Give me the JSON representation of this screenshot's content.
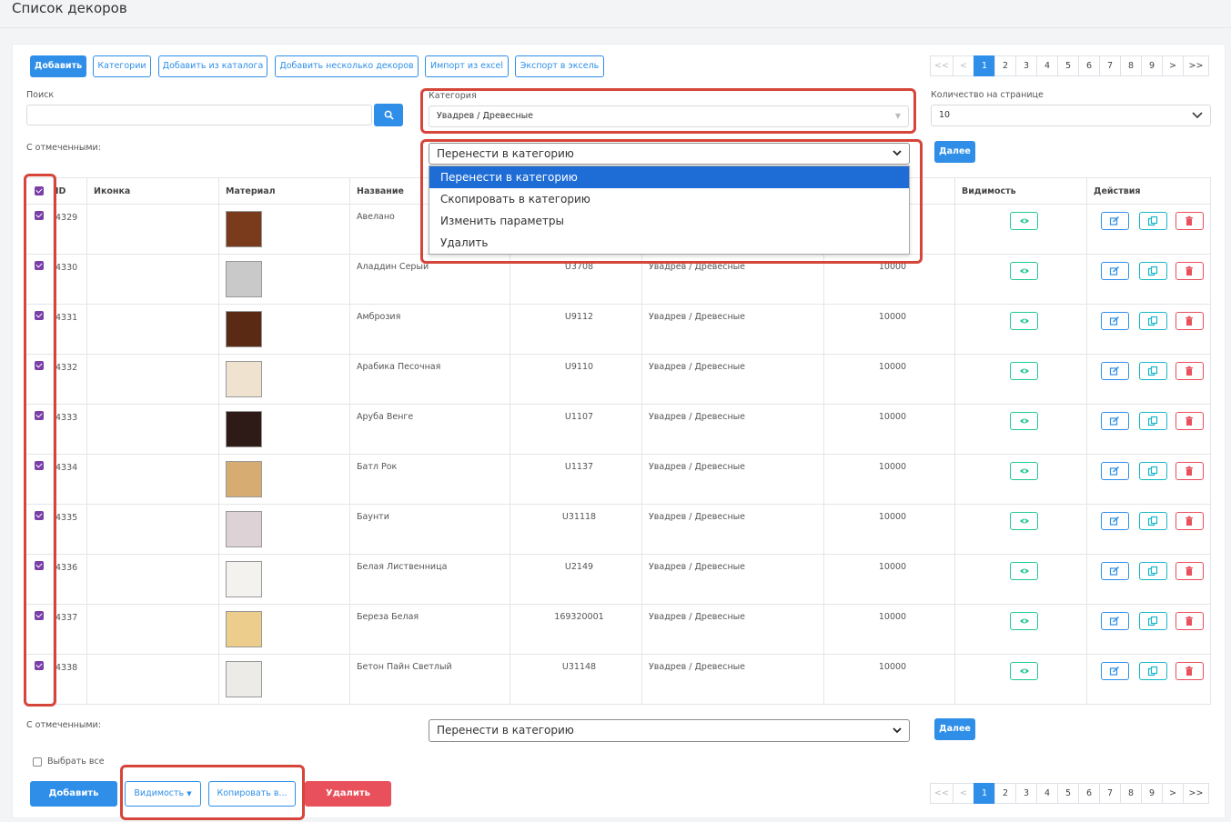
{
  "page": {
    "title": "Список декоров"
  },
  "toolbar": {
    "add": "Добавить",
    "categories": "Категории",
    "add_from_catalog": "Добавить из каталога",
    "add_multiple": "Добавить несколько декоров",
    "import_excel": "Импорт из excel",
    "export_excel": "Экспорт в эксель"
  },
  "pagination": {
    "first": "<<",
    "prev": "<",
    "pages": [
      "1",
      "2",
      "3",
      "4",
      "5",
      "6",
      "7",
      "8",
      "9"
    ],
    "current": "1",
    "next": ">",
    "last": ">>"
  },
  "filters": {
    "search_label": "Поиск",
    "search_value": "",
    "category_label": "Категория",
    "category_value": "Увадрев / Древесные",
    "per_page_label": "Количество на странице",
    "per_page_value": "10"
  },
  "bulk": {
    "label": "С отмеченными:",
    "action_value": "Перенести в категорию",
    "next_button": "Далее",
    "options": [
      "Перенести в категорию",
      "Скопировать в категорию",
      "Изменить параметры",
      "Удалить"
    ]
  },
  "table": {
    "headers": {
      "id": "ID",
      "icon": "Иконка",
      "material": "Материал",
      "name": "Название",
      "visibility": "Видимость",
      "actions": "Действия"
    },
    "rows": [
      {
        "id": "4329",
        "name": "Авелано",
        "code": "",
        "category": "",
        "qty": "",
        "color": "#7a3b1c"
      },
      {
        "id": "4330",
        "name": "Аладдин Серый",
        "code": "U3708",
        "category": "Увадрев / Древесные",
        "qty": "10000",
        "color": "#c9c9c9"
      },
      {
        "id": "4331",
        "name": "Амброзия",
        "code": "U9112",
        "category": "Увадрев / Древесные",
        "qty": "10000",
        "color": "#5a2a14"
      },
      {
        "id": "4332",
        "name": "Арабика Песочная",
        "code": "U9110",
        "category": "Увадрев / Древесные",
        "qty": "10000",
        "color": "#efe2cf"
      },
      {
        "id": "4333",
        "name": "Аруба Венге",
        "code": "U1107",
        "category": "Увадрев / Древесные",
        "qty": "10000",
        "color": "#2e1a16"
      },
      {
        "id": "4334",
        "name": "Батл Рок",
        "code": "U1137",
        "category": "Увадрев / Древесные",
        "qty": "10000",
        "color": "#d6ac72"
      },
      {
        "id": "4335",
        "name": "Баунти",
        "code": "U31118",
        "category": "Увадрев / Древесные",
        "qty": "10000",
        "color": "#ddd3d6"
      },
      {
        "id": "4336",
        "name": "Белая Лиственница",
        "code": "U2149",
        "category": "Увадрев / Древесные",
        "qty": "10000",
        "color": "#f4f2ee"
      },
      {
        "id": "4337",
        "name": "Береза Белая",
        "code": "169320001",
        "category": "Увадрев / Древесные",
        "qty": "10000",
        "color": "#eccd8c"
      },
      {
        "id": "4338",
        "name": "Бетон Пайн Светлый",
        "code": "U31148",
        "category": "Увадрев / Древесные",
        "qty": "10000",
        "color": "#ecebe8"
      }
    ]
  },
  "footer": {
    "bulk_label": "С отмеченными:",
    "bulk_value": "Перенести в категорию",
    "next_button": "Далее",
    "select_all": "Выбрать все",
    "add": "Добавить",
    "visibility": "Видимость",
    "copy": "Копировать в...",
    "delete": "Удалить"
  },
  "colors": {
    "primary": "#2f8fe8",
    "danger": "#e8505b",
    "highlight_red": "#d6453a",
    "checkbox": "#7b3fa8",
    "dropdown_highlight": "#1e6cd6"
  }
}
